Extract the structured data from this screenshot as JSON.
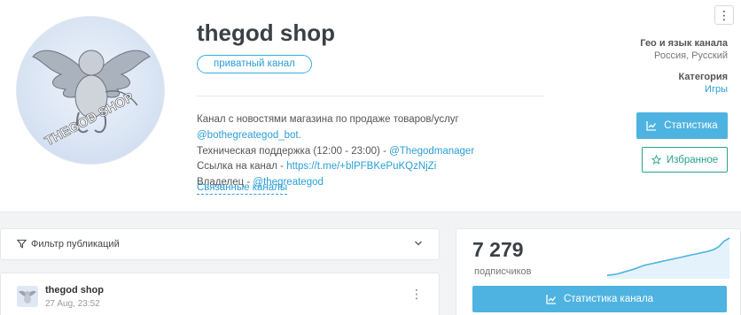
{
  "channel": {
    "title": "thegod shop",
    "badge": "приватный канал",
    "avatar_text": "THEGOD SHOP",
    "description": {
      "line1_text": "Канал с новостями магазина по продаже товаров/услуг ",
      "line1_link": "@bothegreategod_bot.",
      "line2_text": "Техническая поддержка (12:00 - 23:00) - ",
      "line2_link": "@Thegodmanager",
      "line3_text": "Ссылка на канал - ",
      "line3_link": "https://t.me/+blPFBKePuKQzNjZi",
      "line4_text": "Владелец - ",
      "line4_link": "@thegreategod"
    },
    "related_label": "Связанные каналы"
  },
  "meta": {
    "geo_label": "Гео и язык канала",
    "geo_value": "Россия, Русский",
    "category_label": "Категория",
    "category_value": "Игры"
  },
  "actions": {
    "stats_label": "Статистика",
    "favorite_label": "Избранное",
    "kebab": "⋮"
  },
  "filter": {
    "label": "Фильтр публикаций"
  },
  "post": {
    "author": "thegod shop",
    "date": "27 Aug, 23:52"
  },
  "subscribers": {
    "count": "7 279",
    "label": "подписчиков",
    "button_label": "Статистика канала",
    "trend": [
      0.04,
      0.06,
      0.08,
      0.12,
      0.16,
      0.2,
      0.25,
      0.3,
      0.33,
      0.36,
      0.39,
      0.42,
      0.45,
      0.48,
      0.51,
      0.54,
      0.57,
      0.6,
      0.63,
      0.66,
      0.7,
      0.78,
      0.92,
      1.0
    ]
  },
  "colors": {
    "accent": "#4eb3e0",
    "link": "#2a9fd6",
    "favorite": "#28a28e"
  }
}
